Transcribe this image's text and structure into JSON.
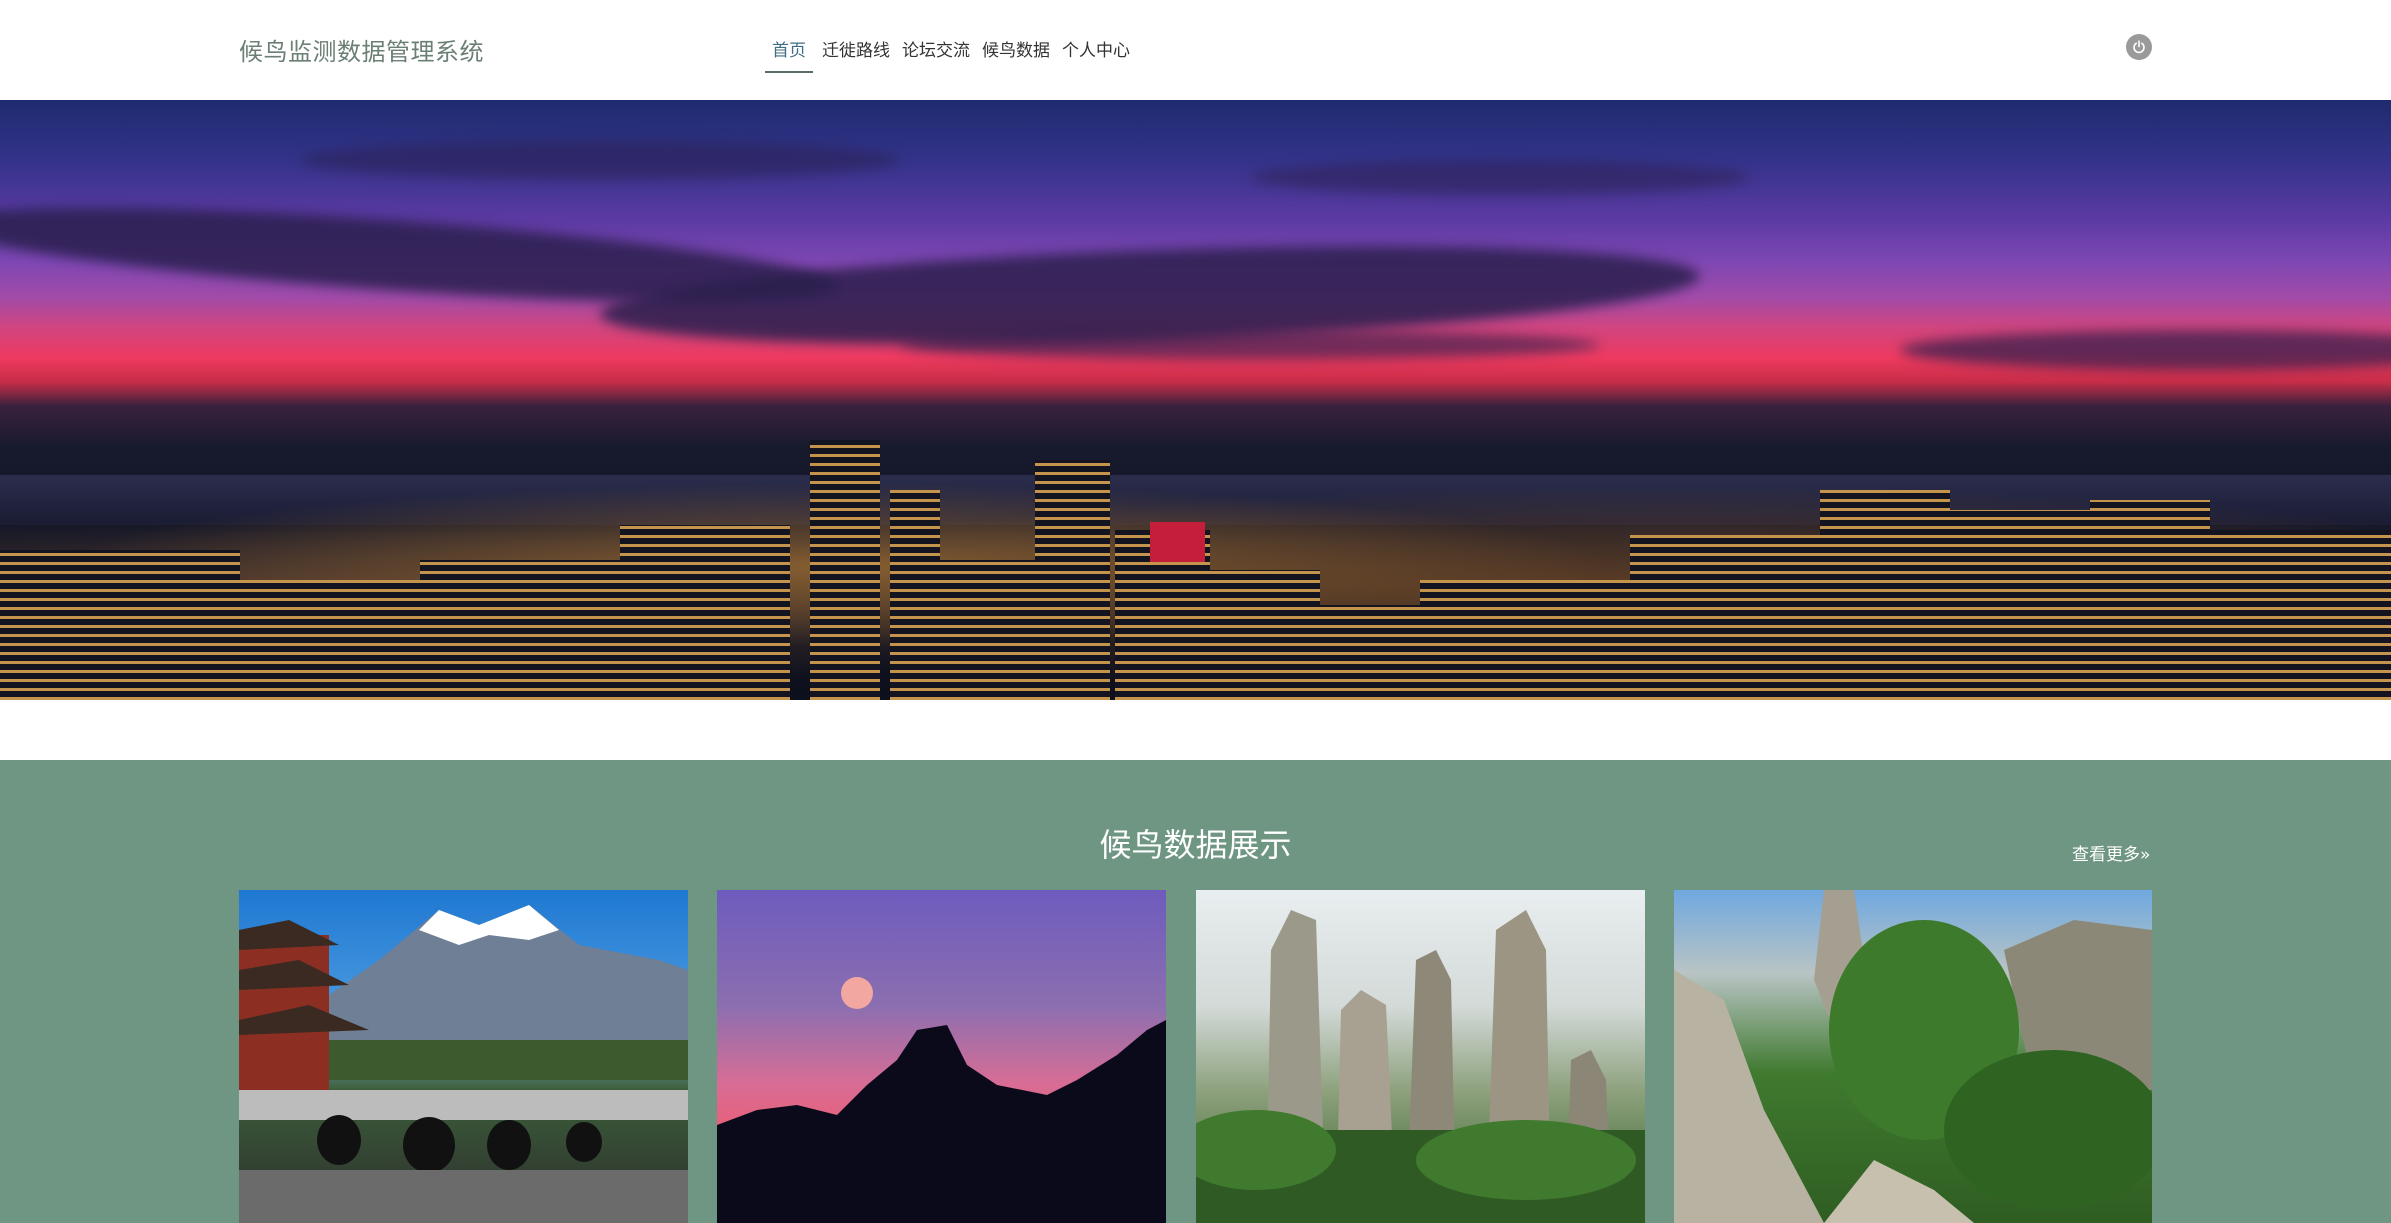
{
  "header": {
    "brand": "候鸟监测数据管理系统",
    "nav": [
      {
        "label": "首页",
        "active": true
      },
      {
        "label": "迁徙路线",
        "active": false
      },
      {
        "label": "论坛交流",
        "active": false
      },
      {
        "label": "候鸟数据",
        "active": false
      },
      {
        "label": "个人中心",
        "active": false
      }
    ],
    "power_icon": "power-icon"
  },
  "hero": {
    "image": "city-night-skyline-banner"
  },
  "section": {
    "title": "候鸟数据展示",
    "more_label": "查看更多",
    "more_icon": "double-chevron-right-icon",
    "cards": [
      {
        "image": "snow-mountain-pagoda-bridge"
      },
      {
        "image": "purple-sky-moon-silhouette"
      },
      {
        "image": "misty-stone-pillars"
      },
      {
        "image": "stone-forest-greenery"
      }
    ]
  },
  "colors": {
    "section_bg": "#6e9683",
    "brand_text": "#6b7f74",
    "nav_active": "#3f6e86",
    "power_button": "#9a9a9a"
  }
}
